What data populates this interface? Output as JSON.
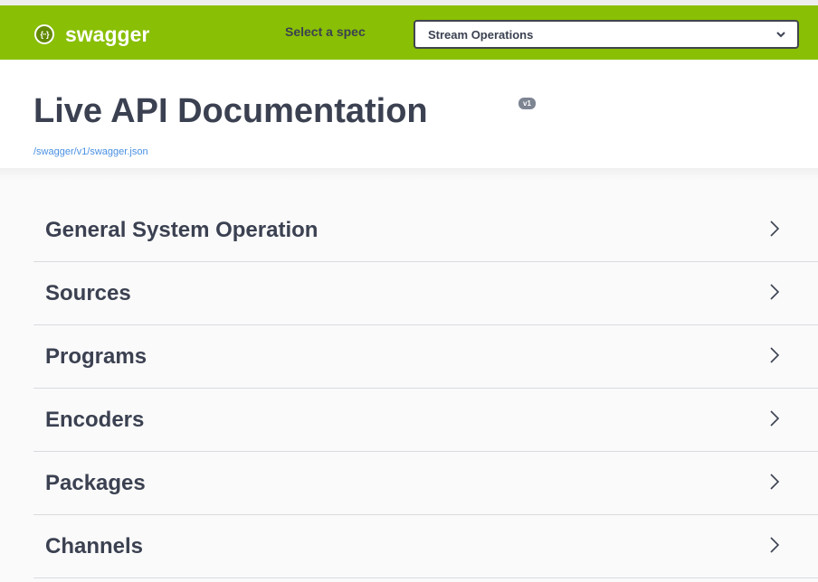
{
  "topbar": {
    "brand_icon_glyph": "{··}",
    "brand_name": "swagger",
    "spec_label": "Select a spec",
    "spec_selected": "Stream Operations",
    "colors": {
      "background": "#89bf04",
      "text": "#ffffff"
    }
  },
  "info": {
    "title": "Live API Documentation",
    "version": "v1",
    "spec_url": "/swagger/v1/swagger.json"
  },
  "tags": [
    {
      "label": "General System Operation"
    },
    {
      "label": "Sources"
    },
    {
      "label": "Programs"
    },
    {
      "label": "Encoders"
    },
    {
      "label": "Packages"
    },
    {
      "label": "Channels"
    }
  ],
  "icons": {
    "brand": "swagger-logo-icon",
    "select": "chevron-down-icon",
    "tag": "chevron-right-icon"
  }
}
